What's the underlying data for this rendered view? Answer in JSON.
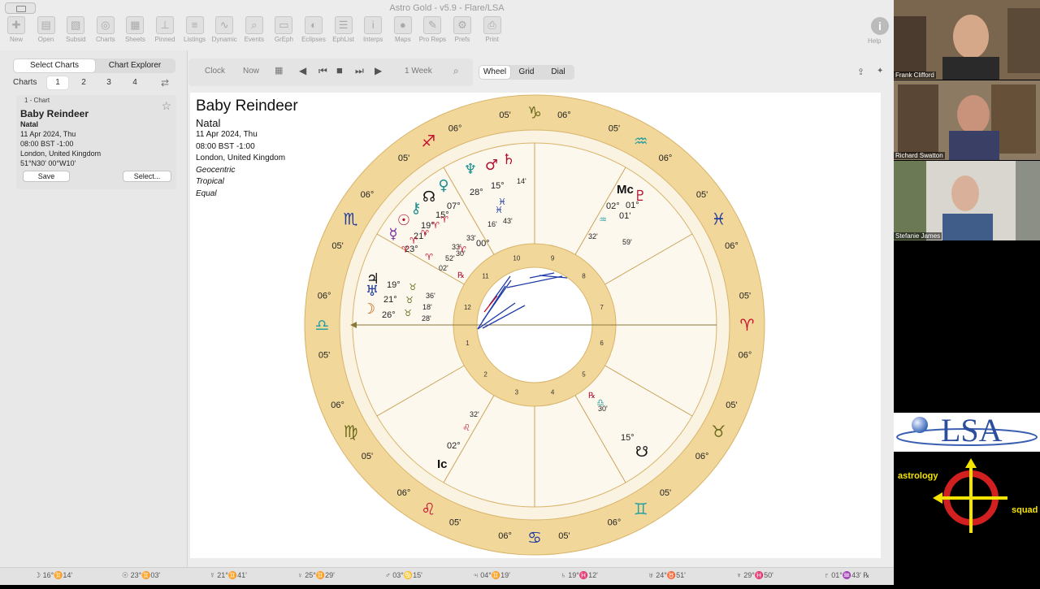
{
  "window": {
    "title": "Astro Gold - v5.9 - Flare/LSA"
  },
  "toolbar": {
    "items": [
      {
        "label": "New",
        "icon": "new-doc-icon"
      },
      {
        "label": "Open",
        "icon": "open-folder-icon"
      },
      {
        "label": "Subsid",
        "icon": "subsid-icon"
      },
      {
        "label": "Charts",
        "icon": "charts-icon"
      },
      {
        "label": "Sheets",
        "icon": "sheets-icon"
      },
      {
        "label": "Pinned",
        "icon": "pin-icon"
      },
      {
        "label": "Listings",
        "icon": "list-icon"
      },
      {
        "label": "Dynamic",
        "icon": "dynamic-icon"
      },
      {
        "label": "Events",
        "icon": "events-icon"
      },
      {
        "label": "GrEph",
        "icon": "graph-icon"
      },
      {
        "label": "Eclipses",
        "icon": "eclipse-icon"
      },
      {
        "label": "EphList",
        "icon": "ephemeris-icon"
      },
      {
        "label": "Interps",
        "icon": "info-icon"
      },
      {
        "label": "Maps",
        "icon": "globe-icon"
      },
      {
        "label": "Pro Reps",
        "icon": "pen-icon"
      },
      {
        "label": "Prefs",
        "icon": "gear-icon"
      },
      {
        "label": "Print",
        "icon": "printer-icon"
      }
    ],
    "help_label": "Help"
  },
  "sidebar": {
    "tabs": [
      "Select Charts",
      "Chart Explorer"
    ],
    "charts_label": "Charts",
    "chart_slots": [
      "1",
      "2",
      "3",
      "4"
    ],
    "card": {
      "header": "1 - Chart",
      "name": "Baby Reindeer",
      "type": "Natal",
      "date": "11 Apr 2024, Thu",
      "time": "08:00 BST -1:00",
      "place": "London, United Kingdom",
      "coords": "51°N30' 00°W10'",
      "save_label": "Save",
      "select_label": "Select..."
    }
  },
  "controls": {
    "clock": "Clock",
    "now": "Now",
    "step": "1 Week",
    "views": [
      "Wheel",
      "Grid",
      "Dial"
    ]
  },
  "chart": {
    "title": "Baby Reindeer",
    "type": "Natal",
    "date": "11 Apr 2024, Thu",
    "time": "08:00 BST -1:00",
    "place": "London, United Kingdom",
    "centric": "Geocentric",
    "zodiac": "Tropical",
    "houses": "Equal",
    "sign_glyphs": [
      "♈",
      "♉",
      "♊",
      "♋",
      "♌",
      "♍",
      "♎",
      "♏",
      "♐",
      "♑",
      "♒",
      "♓"
    ],
    "sign_colors": [
      "#c8102e",
      "#6b6b1e",
      "#2aa0a0",
      "#1e3a9e",
      "#c8102e",
      "#6b6b1e",
      "#2aa0a0",
      "#1e3a9e",
      "#c8102e",
      "#6b6b1e",
      "#2aa0a0",
      "#1e3a9e"
    ],
    "cusp_degree": "06°",
    "cusp_minute": "05'",
    "house_numbers": [
      "1",
      "2",
      "3",
      "4",
      "5",
      "6",
      "7",
      "8",
      "9",
      "10",
      "11",
      "12"
    ],
    "angles": {
      "mc": "Mc",
      "ic": "Ic",
      "mc_deg": "02°",
      "mc_min": "01'",
      "ic_deg": "02°",
      "ic_min": "32'"
    },
    "planets": [
      {
        "glyph": "♇",
        "deg": "01°",
        "min": "59'",
        "note": "32'"
      },
      {
        "glyph": "♄",
        "deg": "15°",
        "min": "14'"
      },
      {
        "glyph": "♆",
        "deg": "28°",
        "min": "16'"
      },
      {
        "glyph": "♂",
        "deg": "00°",
        "min": "43'"
      },
      {
        "glyph": "♀",
        "deg": "07°",
        "min": "33'"
      },
      {
        "glyph": "☊",
        "deg": "15°",
        "min": "30'"
      },
      {
        "glyph": "☉",
        "deg": "21°",
        "min": "33'"
      },
      {
        "glyph": "☿",
        "deg": "23°",
        "min": "52'"
      },
      {
        "glyph": "⚷",
        "deg": "19°",
        "min": "02'"
      },
      {
        "glyph": "♃",
        "deg": "19°",
        "min": "36'"
      },
      {
        "glyph": "♅",
        "deg": "21°",
        "min": "18'"
      },
      {
        "glyph": "☽",
        "deg": "26°",
        "min": "28'"
      },
      {
        "glyph": "☋",
        "deg": "15°",
        "min": "30'"
      }
    ],
    "retro_mark": "℞"
  },
  "status": [
    "☽ 16°♊14'",
    "☉ 23°♊03'",
    "☿ 21°♊41'",
    "♀ 25°♊29'",
    "♂ 03°♋15'",
    "♃ 04°♊19'",
    "♄ 19°♓12'",
    "♅ 24°♉51'",
    "♆ 29°♓50'",
    "♇ 01°♒43' ℞"
  ],
  "participants": [
    "Frank Clifford",
    "Richard Swatton",
    "Stefanie James"
  ],
  "branding": {
    "logo": "LSA",
    "word1": "astrology",
    "word2": "squad"
  }
}
